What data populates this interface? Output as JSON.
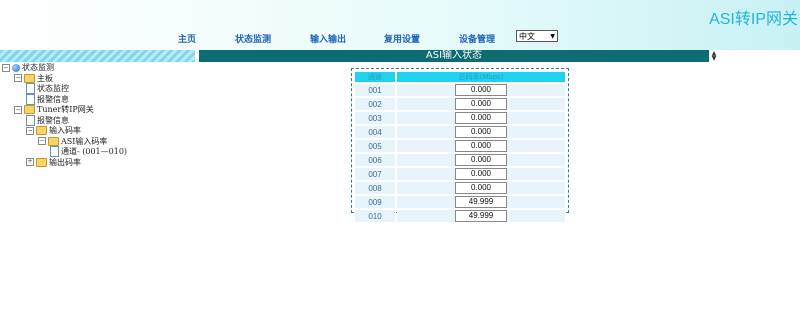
{
  "brand": "ASI转IP网关",
  "nav": [
    "主页",
    "状态监测",
    "输入输出",
    "复用设置",
    "设备管理"
  ],
  "language": "中文",
  "title": "ASI输入状态",
  "tree": [
    {
      "label": "状态监测",
      "icon": "globe",
      "toggle": "⊟",
      "level": 0
    },
    {
      "label": "主板",
      "icon": "folder",
      "toggle": "⊟",
      "level": 1
    },
    {
      "label": "状态监控",
      "icon": "doc",
      "level": 2
    },
    {
      "label": "报警信息",
      "icon": "doc",
      "level": 2
    },
    {
      "label": "Tuner转IP网关",
      "icon": "folder",
      "toggle": "⊟",
      "level": 1
    },
    {
      "label": "报警信息",
      "icon": "doc",
      "level": 2
    },
    {
      "label": "输入码率",
      "icon": "folder",
      "toggle": "⊟",
      "level": 2
    },
    {
      "label": "ASI输入码率",
      "icon": "folder",
      "toggle": "⊟",
      "level": 3
    },
    {
      "label": "通道- (001—010)",
      "icon": "doc",
      "level": 4
    },
    {
      "label": "输出码率",
      "icon": "folder",
      "toggle": "⊞",
      "level": 2
    }
  ],
  "table": {
    "headers": [
      "通道",
      "总码率(Mbps)"
    ],
    "rows": [
      {
        "channel": "001",
        "rate": "0.000"
      },
      {
        "channel": "002",
        "rate": "0.000"
      },
      {
        "channel": "003",
        "rate": "0.000"
      },
      {
        "channel": "004",
        "rate": "0.000"
      },
      {
        "channel": "005",
        "rate": "0.000"
      },
      {
        "channel": "006",
        "rate": "0.000"
      },
      {
        "channel": "007",
        "rate": "0.000"
      },
      {
        "channel": "008",
        "rate": "0.000"
      },
      {
        "channel": "009",
        "rate": "49.999"
      },
      {
        "channel": "010",
        "rate": "49.999"
      }
    ]
  }
}
